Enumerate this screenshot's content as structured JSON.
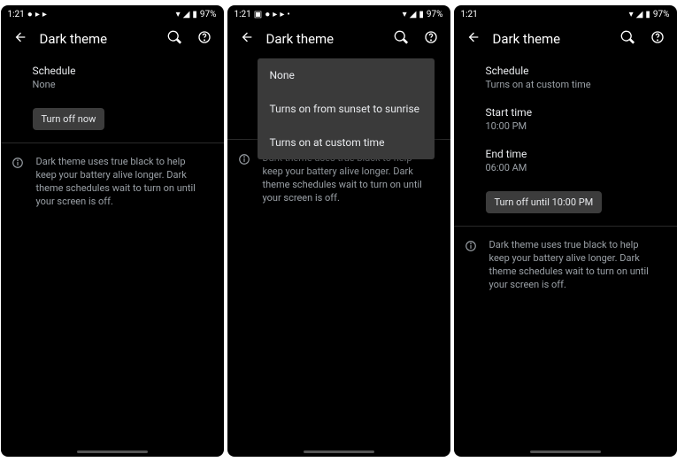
{
  "status": {
    "time": "1:21",
    "battery": "97%"
  },
  "bar": {
    "title": "Dark theme"
  },
  "info_text": "Dark theme uses true black to help keep your battery alive longer. Dark theme schedules wait to turn on until your screen is off.",
  "s1": {
    "schedule_label": "Schedule",
    "schedule_value": "None",
    "turn_off": "Turn off now"
  },
  "s2": {
    "menu": {
      "none": "None",
      "sunset": "Turns on from sunset to sunrise",
      "custom": "Turns on at custom time"
    }
  },
  "s3": {
    "schedule_label": "Schedule",
    "schedule_value": "Turns on at custom time",
    "start_label": "Start time",
    "start_value": "10:00 PM",
    "end_label": "End time",
    "end_value": "06:00 AM",
    "turn_off": "Turn off until 10:00 PM"
  }
}
